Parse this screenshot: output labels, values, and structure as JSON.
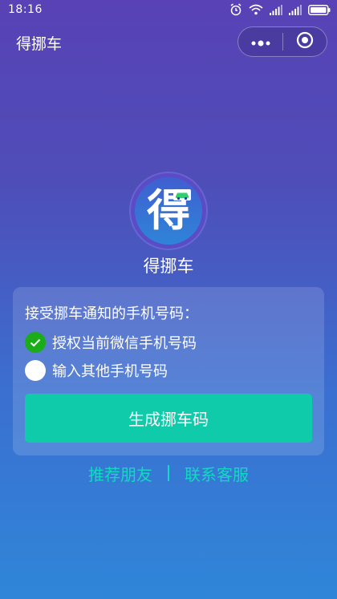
{
  "status_bar": {
    "time": "18:16",
    "icons": [
      "alarm-icon",
      "wifi-icon",
      "signal-icon",
      "signal-icon",
      "battery-icon"
    ]
  },
  "nav": {
    "title": "得挪车",
    "more_icon": "more-dots-icon",
    "close_icon": "target-close-icon"
  },
  "logo": {
    "char": "得",
    "car_icon": "car-icon",
    "accent": "#2fd06e"
  },
  "app_name": "得挪车",
  "card": {
    "title": "接受挪车通知的手机号码：",
    "options": [
      {
        "label": "授权当前微信手机号码",
        "checked": true
      },
      {
        "label": "输入其他手机号码",
        "checked": false
      }
    ],
    "button_label": "生成挪车码"
  },
  "links": {
    "recommend": "推荐朋友",
    "support": "联系客服"
  },
  "colors": {
    "primary_button": "#0fcba9",
    "link": "#13d8c2",
    "radio_checked": "#1aad19",
    "bg_top": "#5842b6",
    "bg_bottom": "#2f86d9"
  }
}
